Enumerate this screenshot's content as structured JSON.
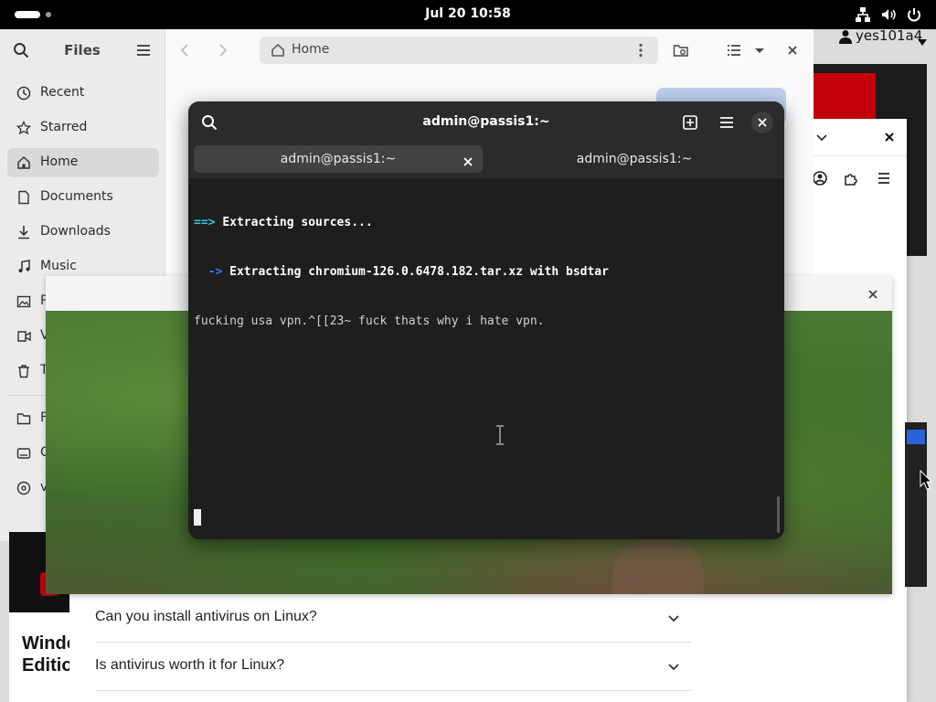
{
  "topbar": {
    "clock": "Jul 20  10:58"
  },
  "user": {
    "name": "yes101a4"
  },
  "files": {
    "title": "Files",
    "sidebar": [
      {
        "label": "Recent",
        "icon": "clock-icon"
      },
      {
        "label": "Starred",
        "icon": "star-icon"
      },
      {
        "label": "Home",
        "icon": "home-icon",
        "active": true
      },
      {
        "label": "Documents",
        "icon": "document-icon"
      },
      {
        "label": "Downloads",
        "icon": "download-icon"
      },
      {
        "label": "Music",
        "icon": "music-icon"
      },
      {
        "label": "P",
        "icon": "pictures-icon"
      },
      {
        "label": "V",
        "icon": "videos-icon"
      },
      {
        "label": "T",
        "icon": "trash-icon"
      },
      {
        "label": "F",
        "icon": "folder-icon"
      },
      {
        "label": "C",
        "icon": "drive-icon"
      },
      {
        "label": "v",
        "icon": "disc-icon"
      }
    ],
    "path": "Home"
  },
  "terminal": {
    "title": "admin@passis1:~",
    "tabs": [
      {
        "label": "admin@passis1:~",
        "active": true
      },
      {
        "label": "admin@passis1:~",
        "active": false
      }
    ],
    "lines": [
      {
        "prefix": "==>",
        "text": "Extracting sources..."
      },
      {
        "prefix": "  ->",
        "text": "Extracting chromium-126.0.6478.182.tar.xz with bsdtar"
      },
      {
        "prefix": "",
        "text": "fucking usa vpn.^[[23~ fuck thats why i hate vpn."
      }
    ]
  },
  "webpage": {
    "faqs": [
      "Can you install antivirus on Linux?",
      "Is antivirus worth it for Linux?"
    ],
    "ad_text": "Windo\nEdition"
  },
  "colors": {
    "terminal_bg": "#1e1e1e",
    "arrow_cyan": "#33c7de",
    "arrow_blue": "#2a7fff"
  }
}
